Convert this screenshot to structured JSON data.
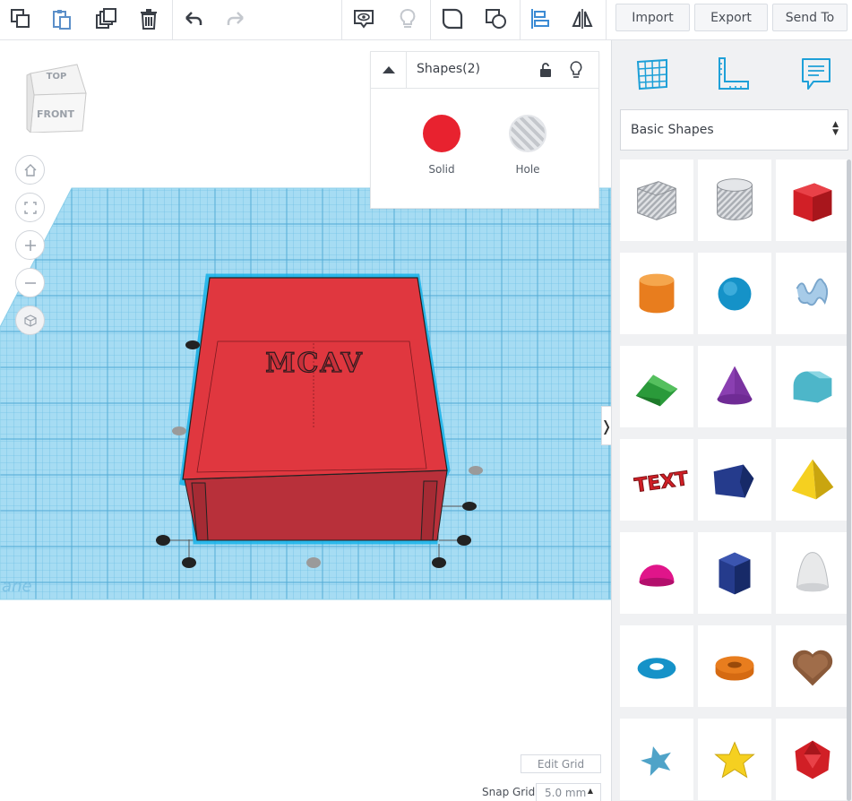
{
  "toolbar": {
    "icons": [
      "copy-icon",
      "paste-icon",
      "duplicate-icon",
      "trash-icon",
      "undo-icon",
      "redo-icon",
      "show-all-icon",
      "lightbulb-icon",
      "group-icon",
      "ungroup-icon",
      "align-icon",
      "mirror-icon"
    ],
    "import_label": "Import",
    "export_label": "Export",
    "send_to_label": "Send To"
  },
  "viewcube": {
    "top_label": "TOP",
    "front_label": "FRONT"
  },
  "nav_buttons": [
    "home-icon",
    "fit-view-icon",
    "zoom-in-icon",
    "zoom-out-icon",
    "perspective-icon"
  ],
  "workplane": {
    "watermark": "ane",
    "model_text": "MCAV",
    "colors": {
      "grid": "#7fc9ea",
      "box": "#e0373f",
      "outline": "#16b2e8"
    }
  },
  "inspector": {
    "title": "Shapes(2)",
    "solid_label": "Solid",
    "hole_label": "Hole",
    "solid_color": "#e8222f"
  },
  "side_toggle": "❭",
  "grid_controls": {
    "edit_grid_label": "Edit Grid",
    "snap_grid_label": "Snap Grid",
    "snap_value": "5.0 mm"
  },
  "panel": {
    "tabs": [
      "workplane-icon",
      "ruler-icon",
      "notes-icon"
    ],
    "category": "Basic Shapes",
    "shapes": [
      "box-hole",
      "cylinder-hole",
      "box",
      "cylinder",
      "sphere",
      "scribble",
      "roof",
      "cone",
      "round-roof",
      "text",
      "polygon",
      "pyramid",
      "half-sphere",
      "prism",
      "paraboloid",
      "torus",
      "tube",
      "heart",
      "star",
      "star-yellow",
      "icosahedron"
    ]
  }
}
